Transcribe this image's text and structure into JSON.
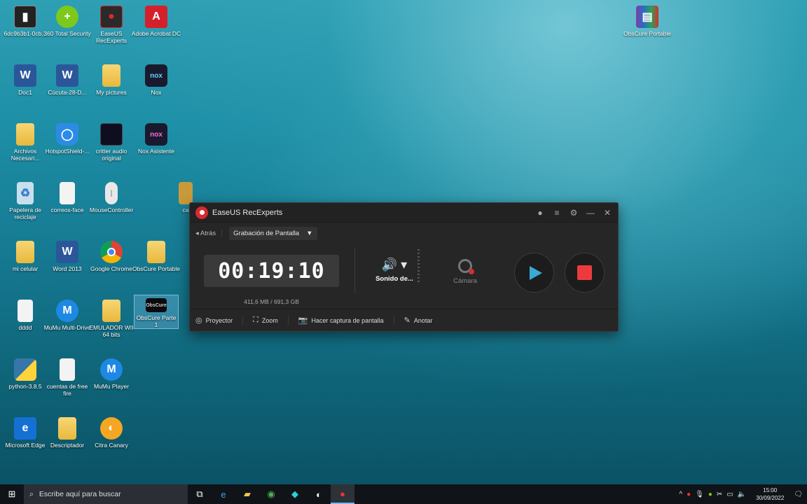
{
  "desktop": {
    "icons": [
      {
        "label": "6dc9b3b1-0cb...",
        "x": 0
      },
      {
        "label": "360 Total Security"
      },
      {
        "label": "EaseUS RecExperts"
      },
      {
        "label": "Adobe Acrobat DC"
      },
      {
        "label": "Doc1"
      },
      {
        "label": "Cúcuta-28-D..."
      },
      {
        "label": "My pictures"
      },
      {
        "label": "Nox"
      },
      {
        "label": "Archivos Necesari..."
      },
      {
        "label": "HotspotShield-..."
      },
      {
        "label": "critter audio original"
      },
      {
        "label": "Nox Asistente"
      },
      {
        "label": "Papelera de reciclaje"
      },
      {
        "label": "correos-face"
      },
      {
        "label": "MouseController"
      },
      {
        "label": "ca"
      },
      {
        "label": "mi celular"
      },
      {
        "label": "Word 2013"
      },
      {
        "label": "Google Chrome"
      },
      {
        "label": "ObsCure Portable"
      },
      {
        "label": "dddd"
      },
      {
        "label": "MuMu Multi-Drive"
      },
      {
        "label": "EMULADOR WII 64 bits"
      },
      {
        "label": "ObsCure Parte 1"
      },
      {
        "label": "python-3.8.5"
      },
      {
        "label": "cuentas de free fire"
      },
      {
        "label": "MuMu Player"
      },
      {
        "label": "Microsoft Edge"
      },
      {
        "label": "Descriptador"
      },
      {
        "label": "Citra Canary"
      },
      {
        "label": "ObsCure Portable"
      }
    ]
  },
  "app": {
    "title": "EaseUS RecExperts",
    "back_label": "Atrás",
    "mode": "Grabación de Pantalla",
    "timer": "00:19:10",
    "storage": "411,6 MB / 691,3 GB",
    "audio_label": "Sonido de...",
    "camera_label": "Cámara",
    "tools": {
      "projector": "Proyector",
      "zoom": "Zoom",
      "screenshot": "Hacer captura de pantalla",
      "annotate": "Anotar"
    }
  },
  "taskbar": {
    "search_placeholder": "Escribe aquí para buscar",
    "time": "15:00",
    "date": "30/09/2022"
  }
}
